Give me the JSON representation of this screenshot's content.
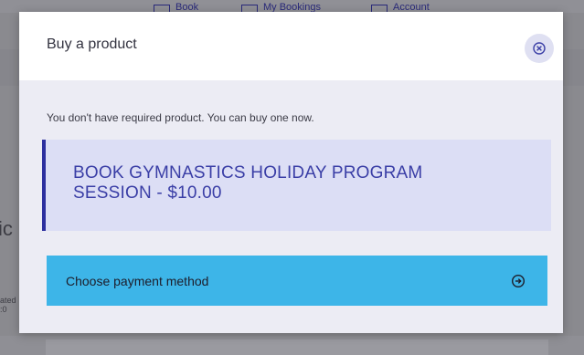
{
  "background": {
    "nav": [
      {
        "label": "Book"
      },
      {
        "label": "My Bookings"
      },
      {
        "label": "Account"
      }
    ],
    "side_text": "ic",
    "side_small_1": "ated",
    "side_small_2": ":0"
  },
  "modal": {
    "title": "Buy a product",
    "message": "You don't have required product. You can buy one now.",
    "product": {
      "name": "BOOK GYMNASTICS HOLIDAY PROGRAM SESSION - $10.00"
    },
    "payment_button_label": "Choose payment method"
  },
  "colors": {
    "accent": "#3db5e8",
    "product_card_bg": "#dcdef5",
    "product_card_border": "#2c2f9e",
    "product_text": "#3a3ea6",
    "close_button_bg": "#dfe0f2"
  }
}
